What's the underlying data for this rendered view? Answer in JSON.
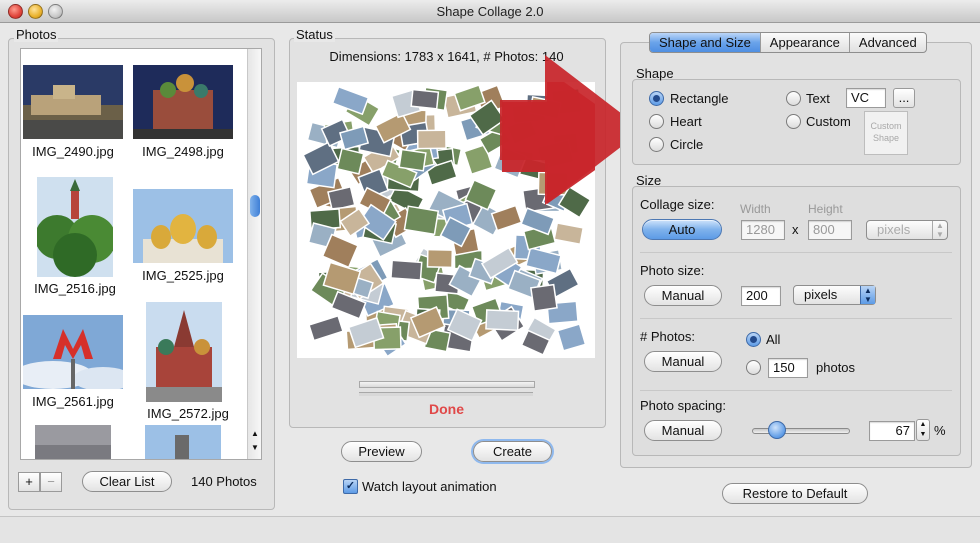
{
  "window": {
    "title": "Shape Collage 2.0"
  },
  "photos_panel": {
    "legend": "Photos",
    "items": [
      {
        "caption": "IMG_2490.jpg"
      },
      {
        "caption": "IMG_2498.jpg"
      },
      {
        "caption": "IMG_2516.jpg"
      },
      {
        "caption": "IMG_2525.jpg"
      },
      {
        "caption": "IMG_2561.jpg"
      },
      {
        "caption": "IMG_2572.jpg"
      }
    ],
    "add_label": "+",
    "remove_label": "−",
    "clear_label": "Clear List",
    "count_text": "140 Photos"
  },
  "status_panel": {
    "legend": "Status",
    "dimensions_text": "Dimensions: 1783 x 1641, # Photos: 140",
    "done_text": "Done",
    "done_color": "#e04848",
    "preview_label": "Preview",
    "create_label": "Create",
    "watch_label": "Watch layout animation",
    "watch_checked": true
  },
  "tabs": [
    {
      "label": "Shape and Size",
      "active": true
    },
    {
      "label": "Appearance",
      "active": false
    },
    {
      "label": "Advanced",
      "active": false
    }
  ],
  "shape": {
    "legend": "Shape",
    "options": [
      {
        "label": "Rectangle",
        "selected": true
      },
      {
        "label": "Heart",
        "selected": false
      },
      {
        "label": "Circle",
        "selected": false
      },
      {
        "label": "Text",
        "selected": false
      },
      {
        "label": "Custom",
        "selected": false
      }
    ],
    "text_value": "VC",
    "ellipsis_label": "...",
    "custom_shape_line1": "Custom",
    "custom_shape_line2": "Shape"
  },
  "size": {
    "legend": "Size",
    "collage_label": "Collage size:",
    "auto_label": "Auto",
    "width_label": "Width",
    "height_label": "Height",
    "width_value": "1280",
    "x_label": "x",
    "height_value": "800",
    "collage_unit": "pixels",
    "photo_size_label": "Photo size:",
    "manual_label": "Manual",
    "photo_size_value": "200",
    "photo_unit": "pixels",
    "num_photos_label": "# Photos:",
    "all_label": "All",
    "photos_value": "150",
    "photos_unit": "photos",
    "spacing_label": "Photo spacing:",
    "spacing_value": "67",
    "percent_label": "%",
    "spacing_level": 0.2
  },
  "restore_label": "Restore to Default",
  "colors": {
    "accent": "#5d9be6",
    "arrow": "#c8262b"
  }
}
